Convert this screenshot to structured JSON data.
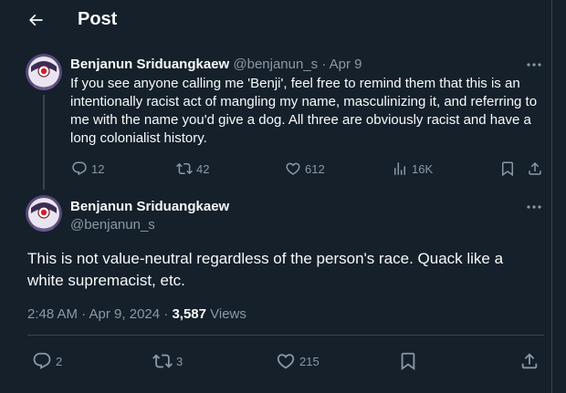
{
  "header": {
    "title": "Post"
  },
  "parent_tweet": {
    "author_name": "Benjanun Sriduangkaew",
    "handle_date": "@benjanun_s · Apr 9",
    "text": "If you see anyone calling me 'Benji', feel free to remind them that this is an intentionally racist act of mangling my name, masculinizing it, and referring to me with the name you'd give a dog. All three are obviously racist and have a long colonialist history.",
    "replies": "12",
    "reposts": "42",
    "likes": "612",
    "views": "16K"
  },
  "main_tweet": {
    "author_name": "Benjanun Sriduangkaew",
    "handle": "@benjanun_s",
    "text": "This is not value-neutral regardless of the person's race. Quack like a white supremacist, etc.",
    "timestamp": "2:48 AM · Apr 9, 2024 · ",
    "views_count": "3,587",
    "views_label": " Views",
    "replies": "2",
    "reposts": "3",
    "likes": "215"
  },
  "colors": {
    "background": "#15202b",
    "text": "#f7f9f9",
    "muted": "#8b98a5",
    "border": "#38444d"
  }
}
